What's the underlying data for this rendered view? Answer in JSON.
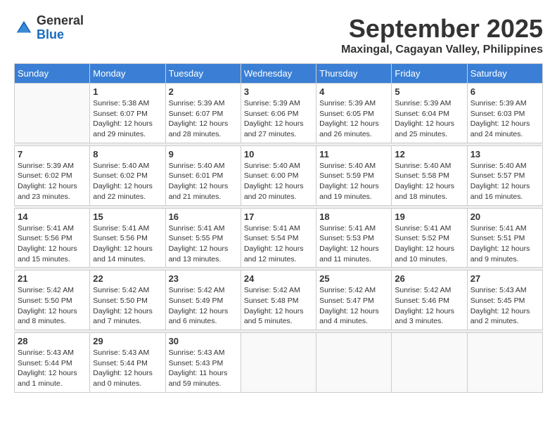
{
  "logo": {
    "line1": "General",
    "line2": "Blue"
  },
  "title": "September 2025",
  "location": "Maxingal, Cagayan Valley, Philippines",
  "weekdays": [
    "Sunday",
    "Monday",
    "Tuesday",
    "Wednesday",
    "Thursday",
    "Friday",
    "Saturday"
  ],
  "weeks": [
    [
      {
        "day": "",
        "info": ""
      },
      {
        "day": "1",
        "info": "Sunrise: 5:38 AM\nSunset: 6:07 PM\nDaylight: 12 hours\nand 29 minutes."
      },
      {
        "day": "2",
        "info": "Sunrise: 5:39 AM\nSunset: 6:07 PM\nDaylight: 12 hours\nand 28 minutes."
      },
      {
        "day": "3",
        "info": "Sunrise: 5:39 AM\nSunset: 6:06 PM\nDaylight: 12 hours\nand 27 minutes."
      },
      {
        "day": "4",
        "info": "Sunrise: 5:39 AM\nSunset: 6:05 PM\nDaylight: 12 hours\nand 26 minutes."
      },
      {
        "day": "5",
        "info": "Sunrise: 5:39 AM\nSunset: 6:04 PM\nDaylight: 12 hours\nand 25 minutes."
      },
      {
        "day": "6",
        "info": "Sunrise: 5:39 AM\nSunset: 6:03 PM\nDaylight: 12 hours\nand 24 minutes."
      }
    ],
    [
      {
        "day": "7",
        "info": "Sunrise: 5:39 AM\nSunset: 6:02 PM\nDaylight: 12 hours\nand 23 minutes."
      },
      {
        "day": "8",
        "info": "Sunrise: 5:40 AM\nSunset: 6:02 PM\nDaylight: 12 hours\nand 22 minutes."
      },
      {
        "day": "9",
        "info": "Sunrise: 5:40 AM\nSunset: 6:01 PM\nDaylight: 12 hours\nand 21 minutes."
      },
      {
        "day": "10",
        "info": "Sunrise: 5:40 AM\nSunset: 6:00 PM\nDaylight: 12 hours\nand 20 minutes."
      },
      {
        "day": "11",
        "info": "Sunrise: 5:40 AM\nSunset: 5:59 PM\nDaylight: 12 hours\nand 19 minutes."
      },
      {
        "day": "12",
        "info": "Sunrise: 5:40 AM\nSunset: 5:58 PM\nDaylight: 12 hours\nand 18 minutes."
      },
      {
        "day": "13",
        "info": "Sunrise: 5:40 AM\nSunset: 5:57 PM\nDaylight: 12 hours\nand 16 minutes."
      }
    ],
    [
      {
        "day": "14",
        "info": "Sunrise: 5:41 AM\nSunset: 5:56 PM\nDaylight: 12 hours\nand 15 minutes."
      },
      {
        "day": "15",
        "info": "Sunrise: 5:41 AM\nSunset: 5:56 PM\nDaylight: 12 hours\nand 14 minutes."
      },
      {
        "day": "16",
        "info": "Sunrise: 5:41 AM\nSunset: 5:55 PM\nDaylight: 12 hours\nand 13 minutes."
      },
      {
        "day": "17",
        "info": "Sunrise: 5:41 AM\nSunset: 5:54 PM\nDaylight: 12 hours\nand 12 minutes."
      },
      {
        "day": "18",
        "info": "Sunrise: 5:41 AM\nSunset: 5:53 PM\nDaylight: 12 hours\nand 11 minutes."
      },
      {
        "day": "19",
        "info": "Sunrise: 5:41 AM\nSunset: 5:52 PM\nDaylight: 12 hours\nand 10 minutes."
      },
      {
        "day": "20",
        "info": "Sunrise: 5:41 AM\nSunset: 5:51 PM\nDaylight: 12 hours\nand 9 minutes."
      }
    ],
    [
      {
        "day": "21",
        "info": "Sunrise: 5:42 AM\nSunset: 5:50 PM\nDaylight: 12 hours\nand 8 minutes."
      },
      {
        "day": "22",
        "info": "Sunrise: 5:42 AM\nSunset: 5:50 PM\nDaylight: 12 hours\nand 7 minutes."
      },
      {
        "day": "23",
        "info": "Sunrise: 5:42 AM\nSunset: 5:49 PM\nDaylight: 12 hours\nand 6 minutes."
      },
      {
        "day": "24",
        "info": "Sunrise: 5:42 AM\nSunset: 5:48 PM\nDaylight: 12 hours\nand 5 minutes."
      },
      {
        "day": "25",
        "info": "Sunrise: 5:42 AM\nSunset: 5:47 PM\nDaylight: 12 hours\nand 4 minutes."
      },
      {
        "day": "26",
        "info": "Sunrise: 5:42 AM\nSunset: 5:46 PM\nDaylight: 12 hours\nand 3 minutes."
      },
      {
        "day": "27",
        "info": "Sunrise: 5:43 AM\nSunset: 5:45 PM\nDaylight: 12 hours\nand 2 minutes."
      }
    ],
    [
      {
        "day": "28",
        "info": "Sunrise: 5:43 AM\nSunset: 5:44 PM\nDaylight: 12 hours\nand 1 minute."
      },
      {
        "day": "29",
        "info": "Sunrise: 5:43 AM\nSunset: 5:44 PM\nDaylight: 12 hours\nand 0 minutes."
      },
      {
        "day": "30",
        "info": "Sunrise: 5:43 AM\nSunset: 5:43 PM\nDaylight: 11 hours\nand 59 minutes."
      },
      {
        "day": "",
        "info": ""
      },
      {
        "day": "",
        "info": ""
      },
      {
        "day": "",
        "info": ""
      },
      {
        "day": "",
        "info": ""
      }
    ]
  ]
}
